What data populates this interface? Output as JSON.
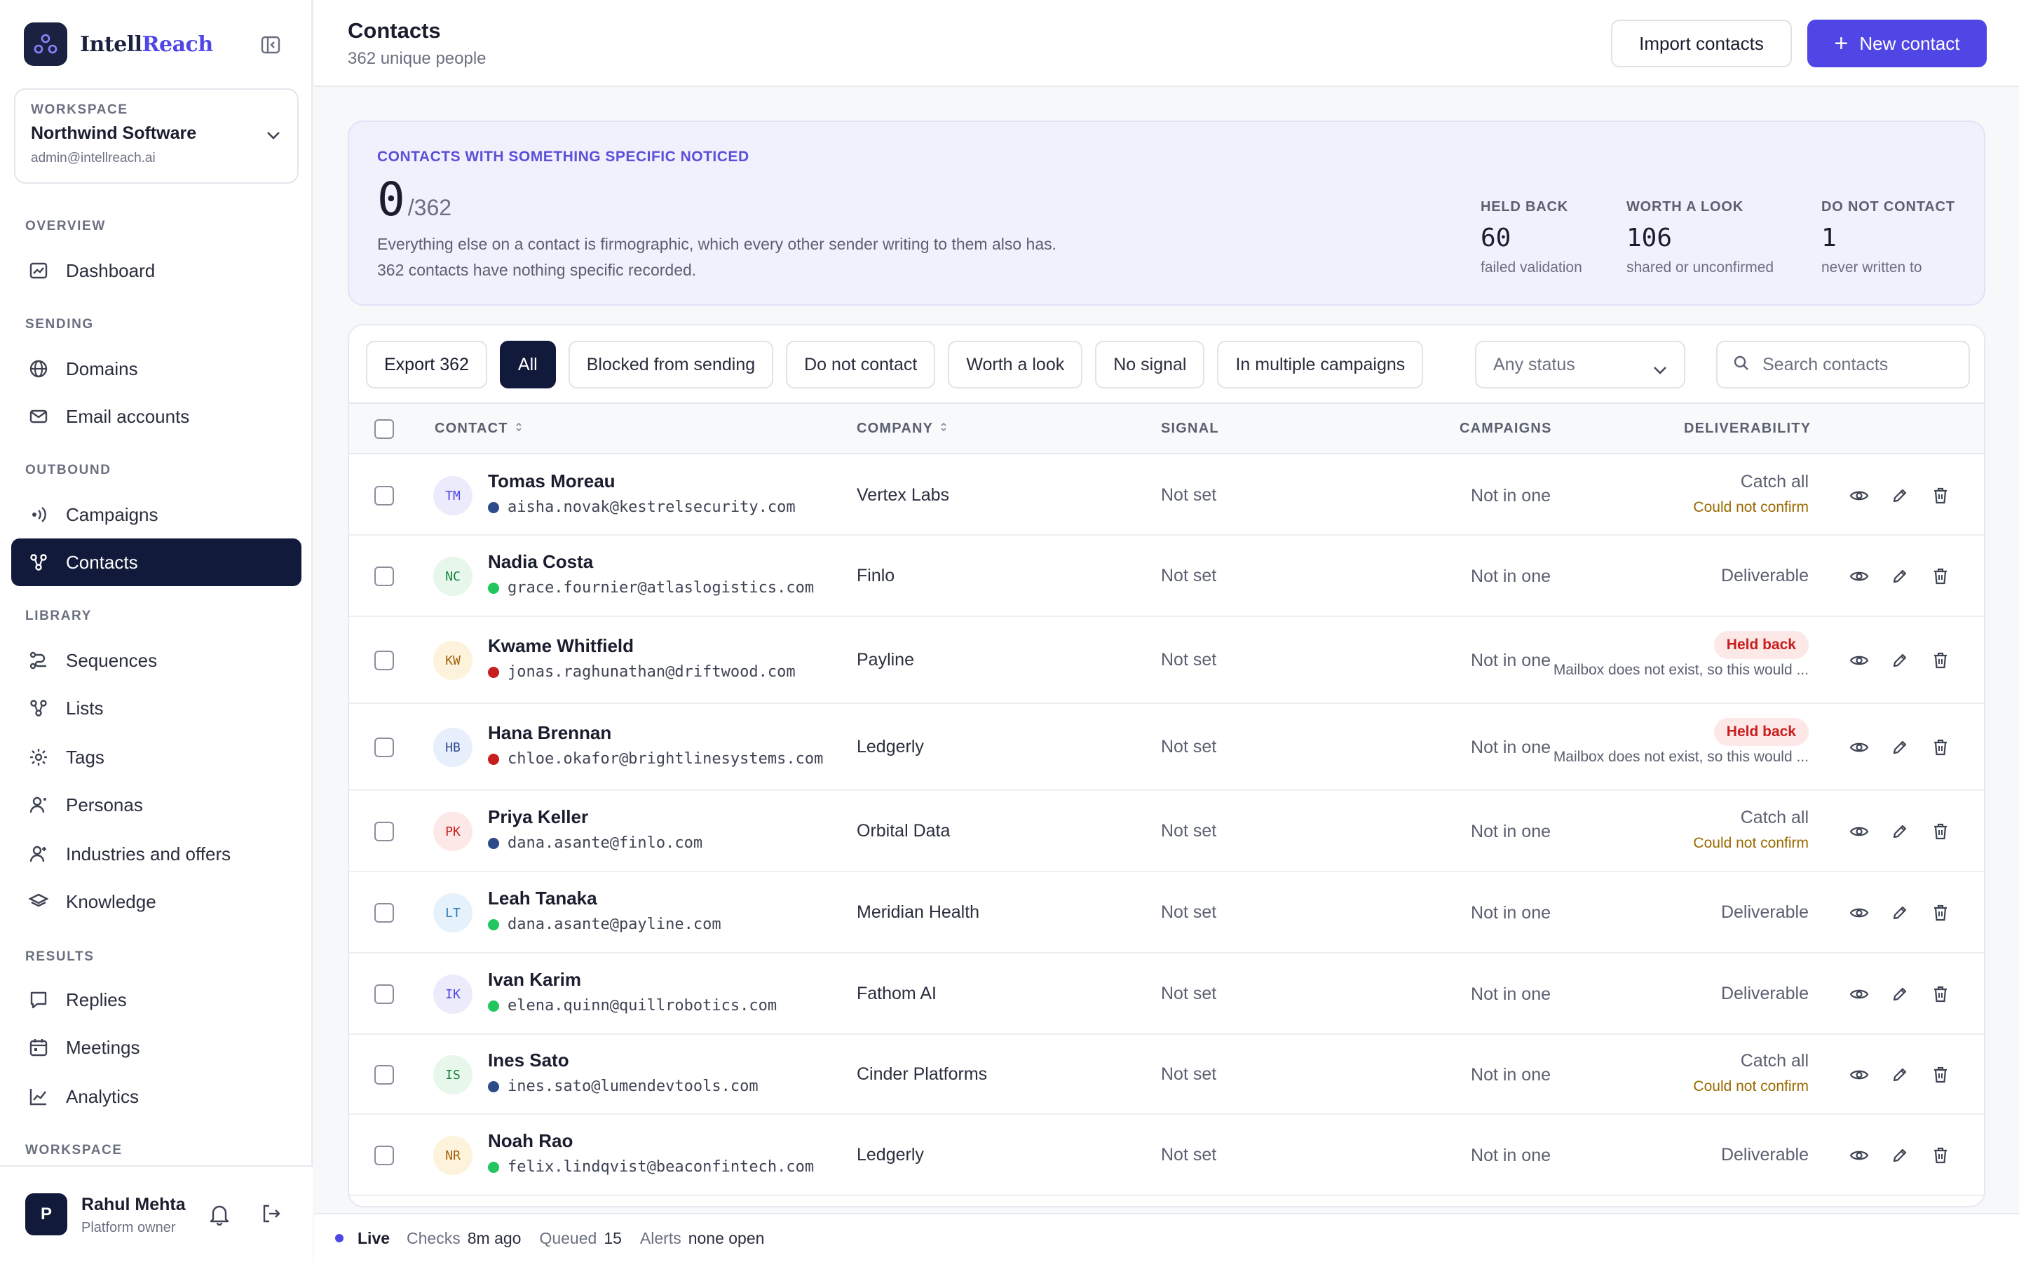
{
  "brand": {
    "name_a": "Intell",
    "name_b": "Reach"
  },
  "workspace": {
    "label": "WORKSPACE",
    "name": "Northwind Software",
    "email": "admin@intellreach.ai"
  },
  "nav": {
    "overview": "OVERVIEW",
    "dashboard": "Dashboard",
    "sending": "SENDING",
    "domains": "Domains",
    "email_accounts": "Email accounts",
    "outbound": "OUTBOUND",
    "campaigns": "Campaigns",
    "contacts": "Contacts",
    "library": "LIBRARY",
    "sequences": "Sequences",
    "lists": "Lists",
    "tags": "Tags",
    "personas": "Personas",
    "industries": "Industries and offers",
    "knowledge": "Knowledge",
    "results": "RESULTS",
    "replies": "Replies",
    "meetings": "Meetings",
    "analytics": "Analytics",
    "workspace": "WORKSPACE"
  },
  "user": {
    "initial": "P",
    "name": "Rahul Mehta",
    "role": "Platform owner"
  },
  "header": {
    "title": "Contacts",
    "subtitle": "362 unique people",
    "import_label": "Import contacts",
    "new_label": "New contact"
  },
  "stats": {
    "label": "CONTACTS WITH SOMETHING SPECIFIC NOTICED",
    "count": "0",
    "total": "/362",
    "desc_line1": "Everything else on a contact is firmographic, which every other sender writing to them also has.",
    "desc_line2": "362 contacts have nothing specific recorded.",
    "held_label": "HELD BACK",
    "held_val": "60",
    "held_sub": "failed validation",
    "worth_label": "WORTH A LOOK",
    "worth_val": "106",
    "worth_sub": "shared or unconfirmed",
    "dnc_label": "DO NOT CONTACT",
    "dnc_val": "1",
    "dnc_sub": "never written to"
  },
  "filters": {
    "export": "Export 362",
    "all": "All",
    "blocked": "Blocked from sending",
    "dnc": "Do not contact",
    "worth": "Worth a look",
    "no_signal": "No signal",
    "multi": "In multiple campaigns",
    "status": "Any status",
    "search_placeholder": "Search contacts"
  },
  "columns": {
    "contact": "CONTACT",
    "company": "COMPANY",
    "signal": "SIGNAL",
    "campaigns": "CAMPAIGNS",
    "deliverability": "DELIVERABILITY"
  },
  "colors": {
    "accent": "#5046e5",
    "navy": "#111a3a",
    "danger": "#c81e1e",
    "warn": "#9a6a00"
  },
  "rows": [
    {
      "initials": "TM",
      "name": "Tomas Moreau",
      "email": "aisha.novak@kestrelsecurity.com",
      "dot": "#2f4a8a",
      "company": "Vertex Labs",
      "signal": "Not set",
      "campaigns": "Not in one",
      "deliv": "Catch all",
      "deliv_sub": "Could not confirm",
      "avatar_bg": "#ecebfb",
      "avatar_fg": "#5046e5"
    },
    {
      "initials": "NC",
      "name": "Nadia Costa",
      "email": "grace.fournier@atlaslogistics.com",
      "dot": "#22c55e",
      "company": "Finlo",
      "signal": "Not set",
      "campaigns": "Not in one",
      "deliv": "Deliverable",
      "avatar_bg": "#e7f7ec",
      "avatar_fg": "#15803d"
    },
    {
      "initials": "KW",
      "name": "Kwame Whitfield",
      "email": "jonas.raghunathan@driftwood.com",
      "dot": "#c81e1e",
      "company": "Payline",
      "signal": "Not set",
      "campaigns": "Not in one",
      "badge": "Held back",
      "note": "Mailbox does not exist, so this would ...",
      "avatar_bg": "#fdf3dc",
      "avatar_fg": "#a16207"
    },
    {
      "initials": "HB",
      "name": "Hana Brennan",
      "email": "chloe.okafor@brightlinesystems.com",
      "dot": "#c81e1e",
      "company": "Ledgerly",
      "signal": "Not set",
      "campaigns": "Not in one",
      "badge": "Held back",
      "note": "Mailbox does not exist, so this would ...",
      "avatar_bg": "#e8effc",
      "avatar_fg": "#2f4a8a"
    },
    {
      "initials": "PK",
      "name": "Priya Keller",
      "email": "dana.asante@finlo.com",
      "dot": "#2f4a8a",
      "company": "Orbital Data",
      "signal": "Not set",
      "campaigns": "Not in one",
      "deliv": "Catch all",
      "deliv_sub": "Could not confirm",
      "avatar_bg": "#fde8e8",
      "avatar_fg": "#c81e1e"
    },
    {
      "initials": "LT",
      "name": "Leah Tanaka",
      "email": "dana.asante@payline.com",
      "dot": "#22c55e",
      "company": "Meridian Health",
      "signal": "Not set",
      "campaigns": "Not in one",
      "deliv": "Deliverable",
      "avatar_bg": "#e6f2fb",
      "avatar_fg": "#2b78b8"
    },
    {
      "initials": "IK",
      "name": "Ivan Karim",
      "email": "elena.quinn@quillrobotics.com",
      "dot": "#22c55e",
      "company": "Fathom AI",
      "signal": "Not set",
      "campaigns": "Not in one",
      "deliv": "Deliverable",
      "avatar_bg": "#ecebfb",
      "avatar_fg": "#5046e5"
    },
    {
      "initials": "IS",
      "name": "Ines Sato",
      "email": "ines.sato@lumendevtools.com",
      "dot": "#2f4a8a",
      "company": "Cinder Platforms",
      "signal": "Not set",
      "campaigns": "Not in one",
      "deliv": "Catch all",
      "deliv_sub": "Could not confirm",
      "avatar_bg": "#e7f7ec",
      "avatar_fg": "#15803d"
    },
    {
      "initials": "NR",
      "name": "Noah Rao",
      "email": "felix.lindqvist@beaconfintech.com",
      "dot": "#22c55e",
      "company": "Ledgerly",
      "signal": "Not set",
      "campaigns": "Not in one",
      "deliv": "Deliverable",
      "avatar_bg": "#fdf3dc",
      "avatar_fg": "#a16207"
    }
  ],
  "status_bar": {
    "live": "Live",
    "checks_label": "Checks",
    "checks_val": "8m ago",
    "queued_label": "Queued",
    "queued_val": "15",
    "alerts_label": "Alerts",
    "alerts_val": "none open"
  }
}
